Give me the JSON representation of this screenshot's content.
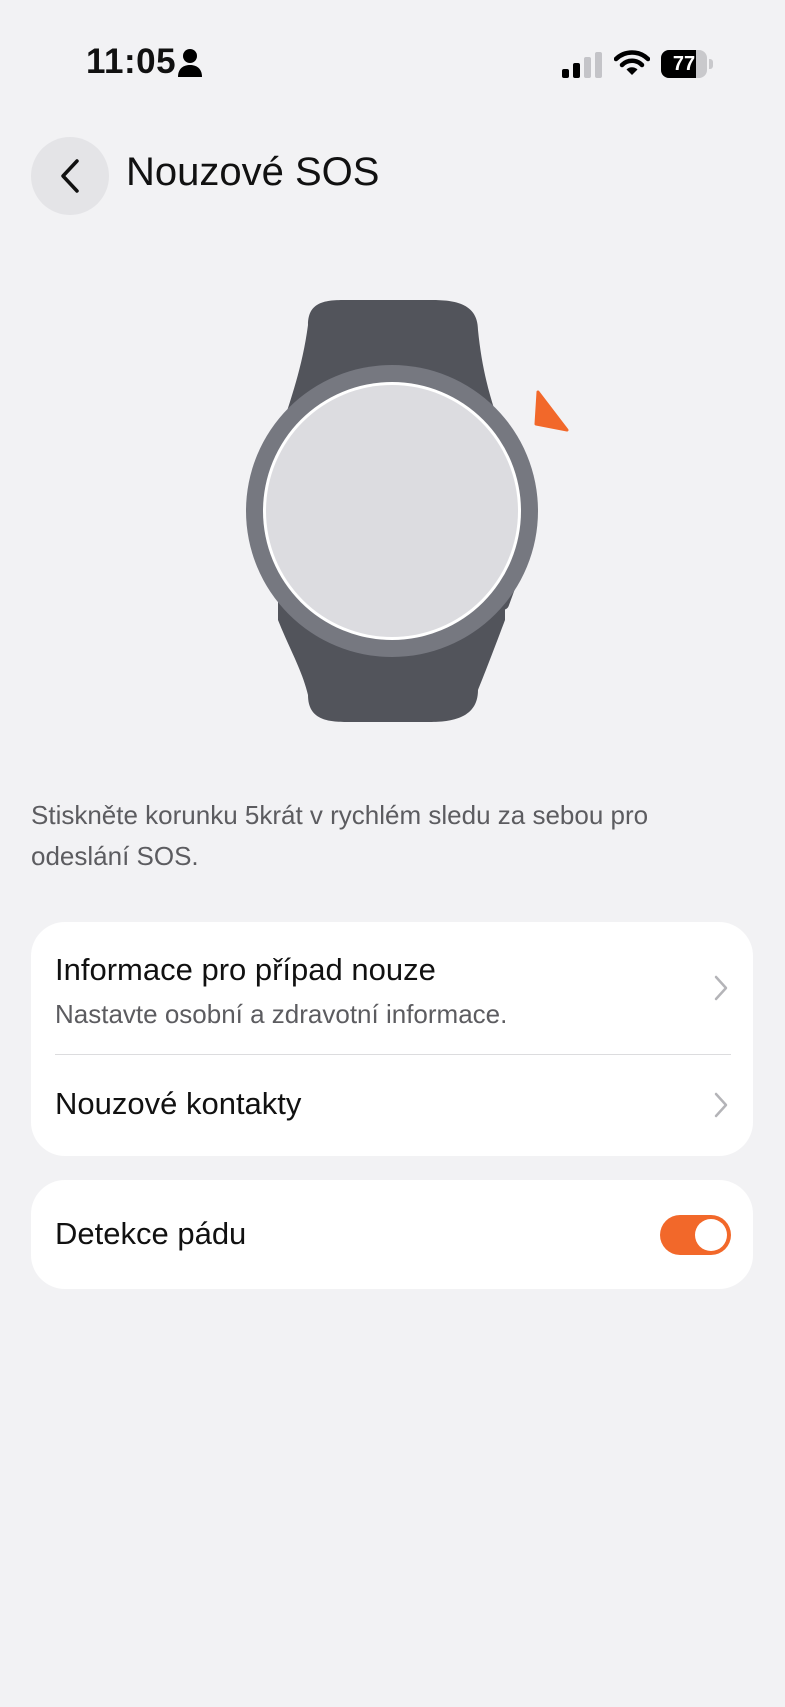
{
  "status_bar": {
    "time": "11:05",
    "battery_percent": "77",
    "battery_level": 0.77
  },
  "header": {
    "title": "Nouzové SOS"
  },
  "description": "Stiskněte korunku 5krát v rychlém sledu za sebou pro odeslání SOS.",
  "settings": {
    "emergency_info": {
      "title": "Informace pro případ nouze",
      "subtitle": "Nastavte osobní a zdravotní informace."
    },
    "emergency_contacts": {
      "title": "Nouzové kontakty"
    },
    "fall_detection": {
      "title": "Detekce pádu",
      "enabled": true
    }
  },
  "colors": {
    "accent": "#f2682a",
    "background": "#f2f2f4",
    "card": "#ffffff",
    "watch_body": "#52545b",
    "watch_bezel": "#767880",
    "watch_face": "#dcdce0"
  }
}
